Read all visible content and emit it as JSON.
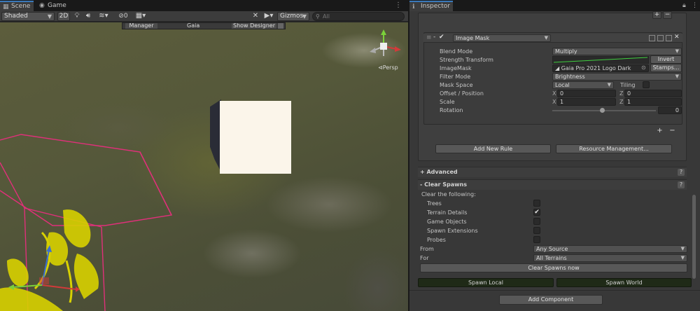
{
  "scene_panel": {
    "tabs": [
      {
        "label": "Scene",
        "icon": "scene-icon",
        "active": true
      },
      {
        "label": "Game",
        "icon": "game-icon",
        "active": false
      }
    ],
    "toolbar": {
      "shading_mode": "Shaded",
      "mode_2d": "2D",
      "hidden_count": "0",
      "gizmos_label": "Gizmos",
      "search_placeholder": "All"
    },
    "overlay": {
      "manager_label": "Manager",
      "title": "Gaia",
      "show_designer_label": "Show Designer"
    },
    "persp_label": "Persp"
  },
  "inspector": {
    "tab_label": "Inspector",
    "image_mask": {
      "header_label": "Image Mask",
      "rows": {
        "blend_mode": {
          "label": "Blend Mode",
          "value": "Multiply"
        },
        "strength_transform": {
          "label": "Strength Transform",
          "button": "Invert"
        },
        "image_mask": {
          "label": "ImageMask",
          "value": "Gaia Pro 2021 Logo Dark",
          "button": "Stamps..."
        },
        "filter_mode": {
          "label": "Filter Mode",
          "value": "Brightness"
        },
        "mask_space": {
          "label": "Mask Space",
          "value": "Local",
          "tiling_label": "Tiling"
        },
        "offset": {
          "label": "Offset / Position",
          "x_label": "X",
          "x": "0",
          "z_label": "Z",
          "z": "0"
        },
        "scale": {
          "label": "Scale",
          "x_label": "X",
          "x": "1",
          "z_label": "Z",
          "z": "1"
        },
        "rotation": {
          "label": "Rotation",
          "value": "0",
          "slider_fraction": 0.48
        }
      }
    },
    "rules_buttons": {
      "add_new_rule": "Add New Rule",
      "resource_management": "Resource Management..."
    },
    "advanced": {
      "title": "+ Advanced"
    },
    "clear_spawns": {
      "title": "- Clear Spawns",
      "clear_following_label": "Clear the following:",
      "options": [
        {
          "label": "Trees",
          "checked": false
        },
        {
          "label": "Terrain Details",
          "checked": true
        },
        {
          "label": "Game Objects",
          "checked": false
        },
        {
          "label": "Spawn Extensions",
          "checked": false
        },
        {
          "label": "Probes",
          "checked": false
        }
      ],
      "from": {
        "label": "From",
        "value": "Any Source"
      },
      "for": {
        "label": "For",
        "value": "All Terrains"
      },
      "clear_button": "Clear Spawns now"
    },
    "spawn_local": "Spawn Local",
    "spawn_world": "Spawn World",
    "add_component": "Add Component",
    "plus": "+",
    "minus": "−",
    "help": "?"
  },
  "colors": {
    "accent_tab": "#3a79bb",
    "wireframe": "#e0307a",
    "gizmo_x": "#d23a3a",
    "gizmo_y": "#7bd03a",
    "gizmo_z": "#3a6fd2"
  }
}
